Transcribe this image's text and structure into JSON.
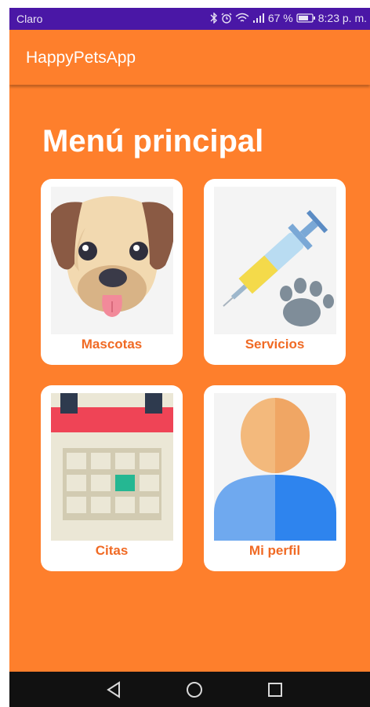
{
  "status_bar": {
    "carrier": "Claro",
    "battery": "67 %",
    "time": "8:23 p. m."
  },
  "app_bar": {
    "title": "HappyPetsApp"
  },
  "main": {
    "heading": "Menú principal",
    "cards": [
      {
        "label": "Mascotas",
        "icon": "dog-icon"
      },
      {
        "label": "Servicios",
        "icon": "syringe-paw-icon"
      },
      {
        "label": "Citas",
        "icon": "calendar-icon"
      },
      {
        "label": "Mi perfil",
        "icon": "user-icon"
      }
    ]
  },
  "nav_bar": {
    "buttons": [
      "back-icon",
      "home-icon",
      "recents-icon"
    ]
  },
  "colors": {
    "primary": "#fe7f2c",
    "status_bar": "#4a17a6",
    "card_label": "#f06a24",
    "nav_bar": "#111111"
  }
}
